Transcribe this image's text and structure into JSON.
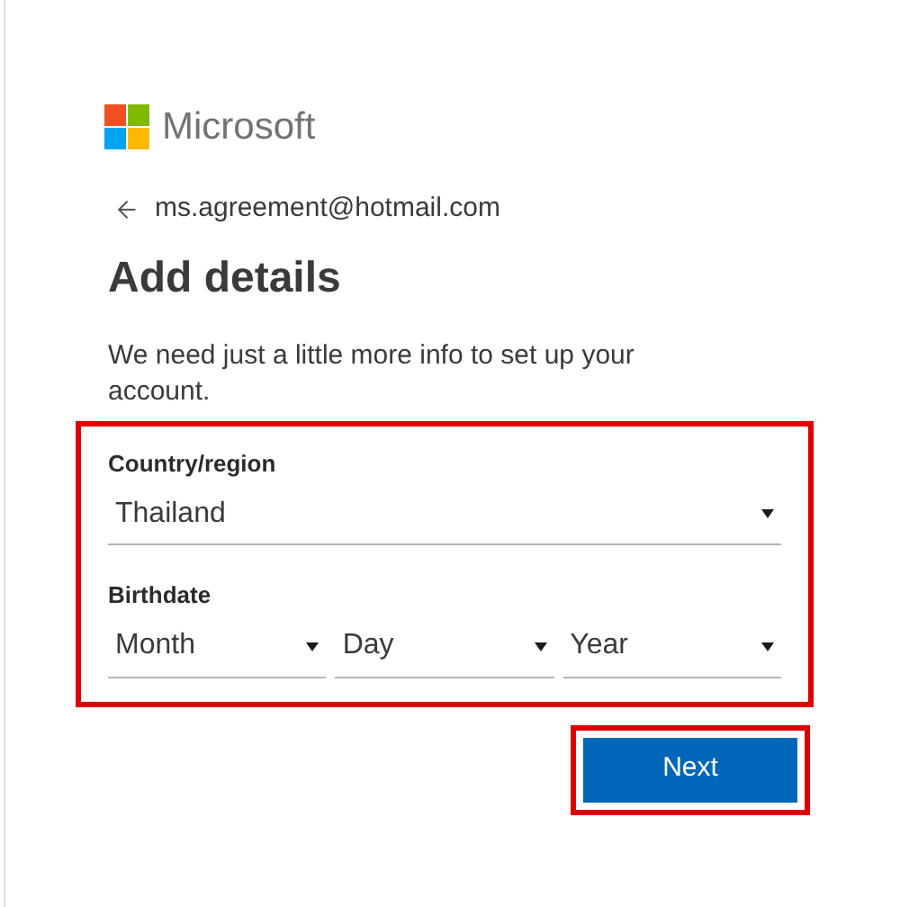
{
  "brand": {
    "name": "Microsoft"
  },
  "account": {
    "email": "ms.agreement@hotmail.com"
  },
  "title": "Add details",
  "description": "We need just a little more info to set up your account.",
  "country": {
    "label": "Country/region",
    "value": "Thailand"
  },
  "birthdate": {
    "label": "Birthdate",
    "selects": [
      {
        "placeholder": "Month"
      },
      {
        "placeholder": "Day"
      },
      {
        "placeholder": "Year"
      }
    ]
  },
  "next_button": {
    "label": "Next"
  }
}
